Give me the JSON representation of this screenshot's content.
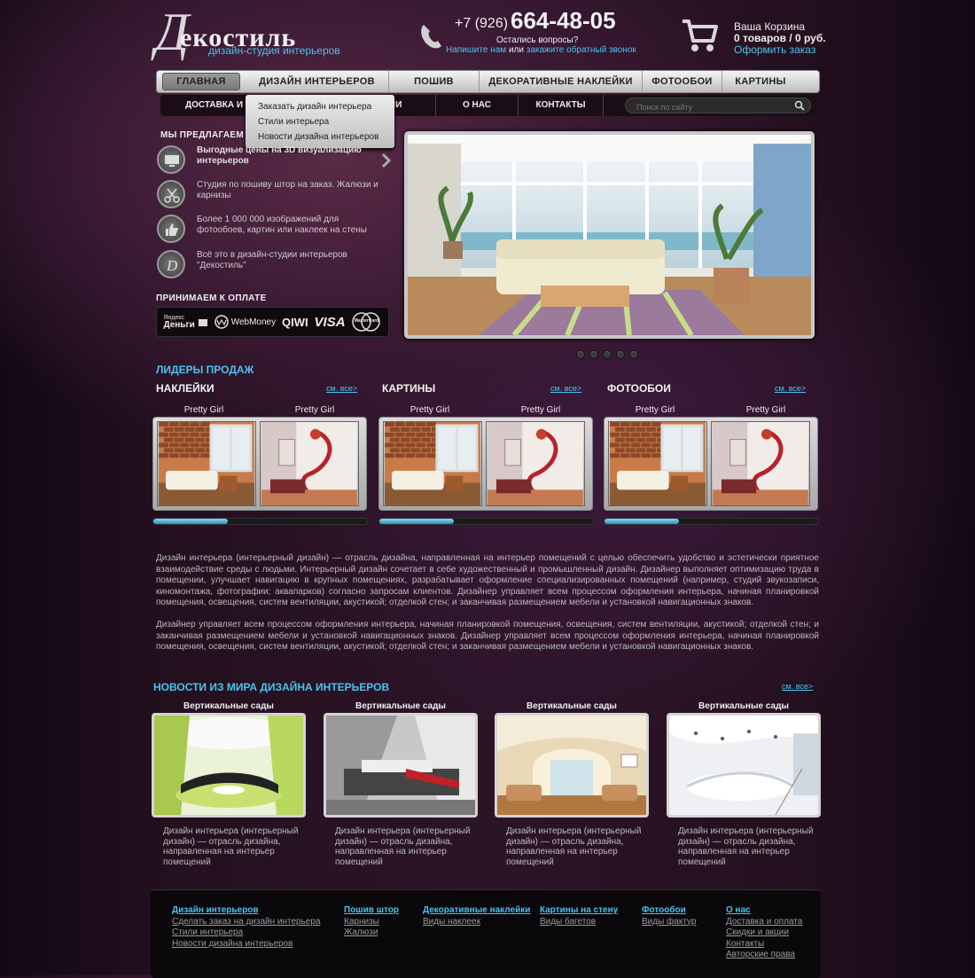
{
  "header": {
    "logo_letter": "Д",
    "logo_name": "екостиль",
    "logo_sub": "дизайн-студия интерьеров",
    "phone_prefix": "+7 (926)",
    "phone_number": "664-48-05",
    "phone_question": "Остались вопросы?",
    "link_write": "Напишите нам",
    "link_or": " или ",
    "link_callback": "закажите обратный звонок",
    "cart_title": "Ваша Корзина",
    "cart_status": "0 товаров / 0 руб.",
    "cart_checkout": "Оформить заказ"
  },
  "nav_main": [
    "ГЛАВНАЯ",
    "ДИЗАЙН ИНТЕРЬЕРОВ",
    "ПОШИВ ШТОР",
    "ДЕКОРАТИВНЫЕ НАКЛЕЙКИ",
    "ФОТООБОИ",
    "КАРТИНЫ"
  ],
  "nav_sub": [
    "ДОСТАВКА И О",
    "ИИ",
    "О НАС",
    "КОНТАКТЫ"
  ],
  "search": {
    "placeholder": "Поиск по сайту"
  },
  "dropdown": [
    "Заказать дизайн интерьера",
    "Стили интерьера",
    "Новости дизайна интерьеров"
  ],
  "offers": {
    "title": "МЫ ПРЕДЛАГАЕМ",
    "items": [
      "Выгодные цены на 3D визуализацию интерьеров",
      "Студия по пошиву штор на заказ. Жалюзи и карнизы",
      "Более 1 000 000 изображений для фотообоев, картин или наклеек на стены",
      "Всё это в дизайн-студии интерьеров \"Декостиль\""
    ]
  },
  "payment": {
    "title": "ПРИНИМАЕМ К ОПЛАТЕ",
    "yandex_1": "Яндекс",
    "yandex_2": "Деньги",
    "webmoney": "WebMoney",
    "qiwi": "QIWI",
    "visa": "VISA",
    "mastercard": "MasterCard"
  },
  "leaders": {
    "title": "ЛИДЕРЫ ПРОДАЖ",
    "see_all": "см. все>",
    "categories": [
      {
        "name": "НАКЛЕЙКИ",
        "items": [
          "Pretty Girl",
          "Pretty Girl"
        ],
        "progress": 0.35
      },
      {
        "name": "КАРТИНЫ",
        "items": [
          "Pretty Girl",
          "Pretty Girl"
        ],
        "progress": 0.35
      },
      {
        "name": "ФОТООБОИ",
        "items": [
          "Pretty Girl",
          "Pretty Girl"
        ],
        "progress": 0.35
      }
    ]
  },
  "article": {
    "p1": "Дизайн интерьера (интерьерный дизайн) — отрасль дизайна, направленная на интерьер помещений с целью обеспечить удобство и эстетически приятное взаимодействие среды с людьми. Интерьерный дизайн сочетает в себе художественный и промышленный дизайн. Дизайнер выполняет оптимизацию труда в помещении, улучшает навигацию в крупных помещениях, разрабатывает оформление специализированных помещений (например, студий звукозаписи, киномонтажа, фотографии; аквапарков) согласно запросам клиентов. Дизайнер управляет всем процессом оформления интерьера, начиная планировкой помещения, освещения, систем вентиляции, акустикой; отделкой стен; и заканчивая размещением мебели и установкой навигационных знаков.",
    "p2": "Дизайнер управляет всем процессом оформления интерьера, начиная планировкой помещения, освещения, систем вентиляции, акустикой; отделкой стен; и заканчивая размещением мебели и установкой навигационных знаков. Дизайнер управляет всем процессом оформления интерьера, начиная планировкой помещения, освещения, систем вентиляции, акустикой; отделкой стен; и заканчивая размещением мебели и установкой навигационных знаков."
  },
  "news": {
    "title": "НОВОСТИ ИЗ МИРА ДИЗАЙНА ИНТЕРЬЕРОВ",
    "see_all": "см. все>",
    "items": [
      {
        "caption": "Вертикальные сады",
        "text": "Дизайн интерьера (интерьерный дизайн) — отрасль дизайна, направленная на интерьер помещений"
      },
      {
        "caption": "Вертикальные сады",
        "text": "Дизайн интерьера (интерьерный дизайн) — отрасль дизайна, направленная на интерьер помещений"
      },
      {
        "caption": "Вертикальные сады",
        "text": "Дизайн интерьера (интерьерный дизайн) — отрасль дизайна, направленная на интерьер помещений"
      },
      {
        "caption": "Вертикальные сады",
        "text": "Дизайн интерьера (интерьерный дизайн) — отрасль дизайна, направленная на интерьер помещений"
      }
    ]
  },
  "footer": [
    {
      "head": "Дизайн интерьеров",
      "links": [
        "Сделать заказ на дизайн интерьера",
        "Стили интерьера",
        "Новости дизайна интерьеров"
      ]
    },
    {
      "head": "Пошив штор",
      "links": [
        "Карнизы",
        "Жалюзи"
      ]
    },
    {
      "head": "Декоративные наклейки",
      "links": [
        "Виды наклеек"
      ]
    },
    {
      "head": "Картины на стену",
      "links": [
        "Виды багетов"
      ]
    },
    {
      "head": "Фотообои",
      "links": [
        "Виды фактур"
      ]
    },
    {
      "head": "О нас",
      "links": [
        "Доставка и оплата",
        "Скидки и акции",
        "Контакты",
        "Авторские права"
      ]
    }
  ],
  "colors": {
    "accent": "#4cc3ee",
    "background": "#2c1428"
  }
}
